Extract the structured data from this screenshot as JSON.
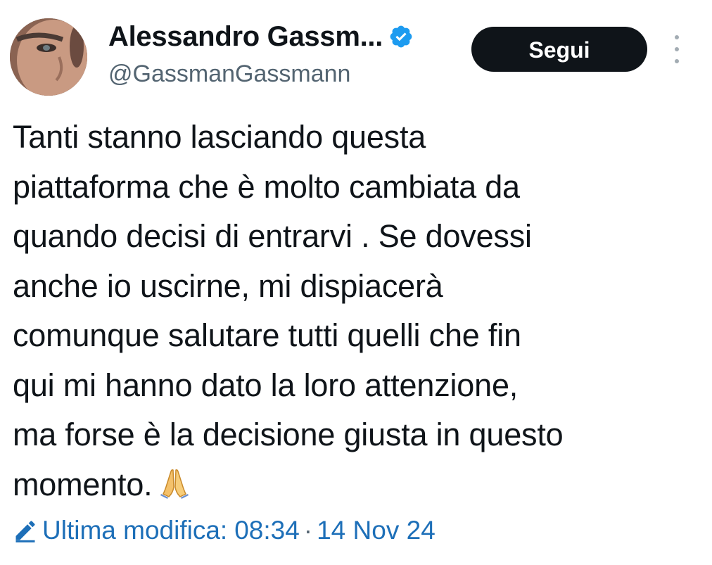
{
  "author": {
    "name": "Alessandro Gassm...",
    "handle": "@GassmanGassmann",
    "verified": true,
    "avatar_icon": "profile-photo"
  },
  "actions": {
    "follow_label": "Segui",
    "more_icon": "vertical-ellipsis-icon"
  },
  "tweet": {
    "lines": [
      "Tanti stanno lasciando questa",
      "piattaforma che è molto cambiata da",
      "quando decisi di entrarvi . Se dovessi",
      "anche io uscirne, mi dispiacerà",
      "comunque salutare tutti quelli che fin",
      "qui mi hanno dato la loro attenzione,",
      "ma forse è la decisione giusta in questo",
      "momento."
    ],
    "emoji": "folded-hands-emoji"
  },
  "edited": {
    "icon": "pencil-icon",
    "label": "Ultima modifica:",
    "time": "08:34",
    "separator": "·",
    "date": "14 Nov 24"
  },
  "colors": {
    "text_primary": "#0f1419",
    "text_secondary": "#536471",
    "link": "#1d6fb8",
    "verified_badge": "#1d9bf0",
    "button_bg": "#0f1419",
    "button_text": "#ffffff"
  }
}
